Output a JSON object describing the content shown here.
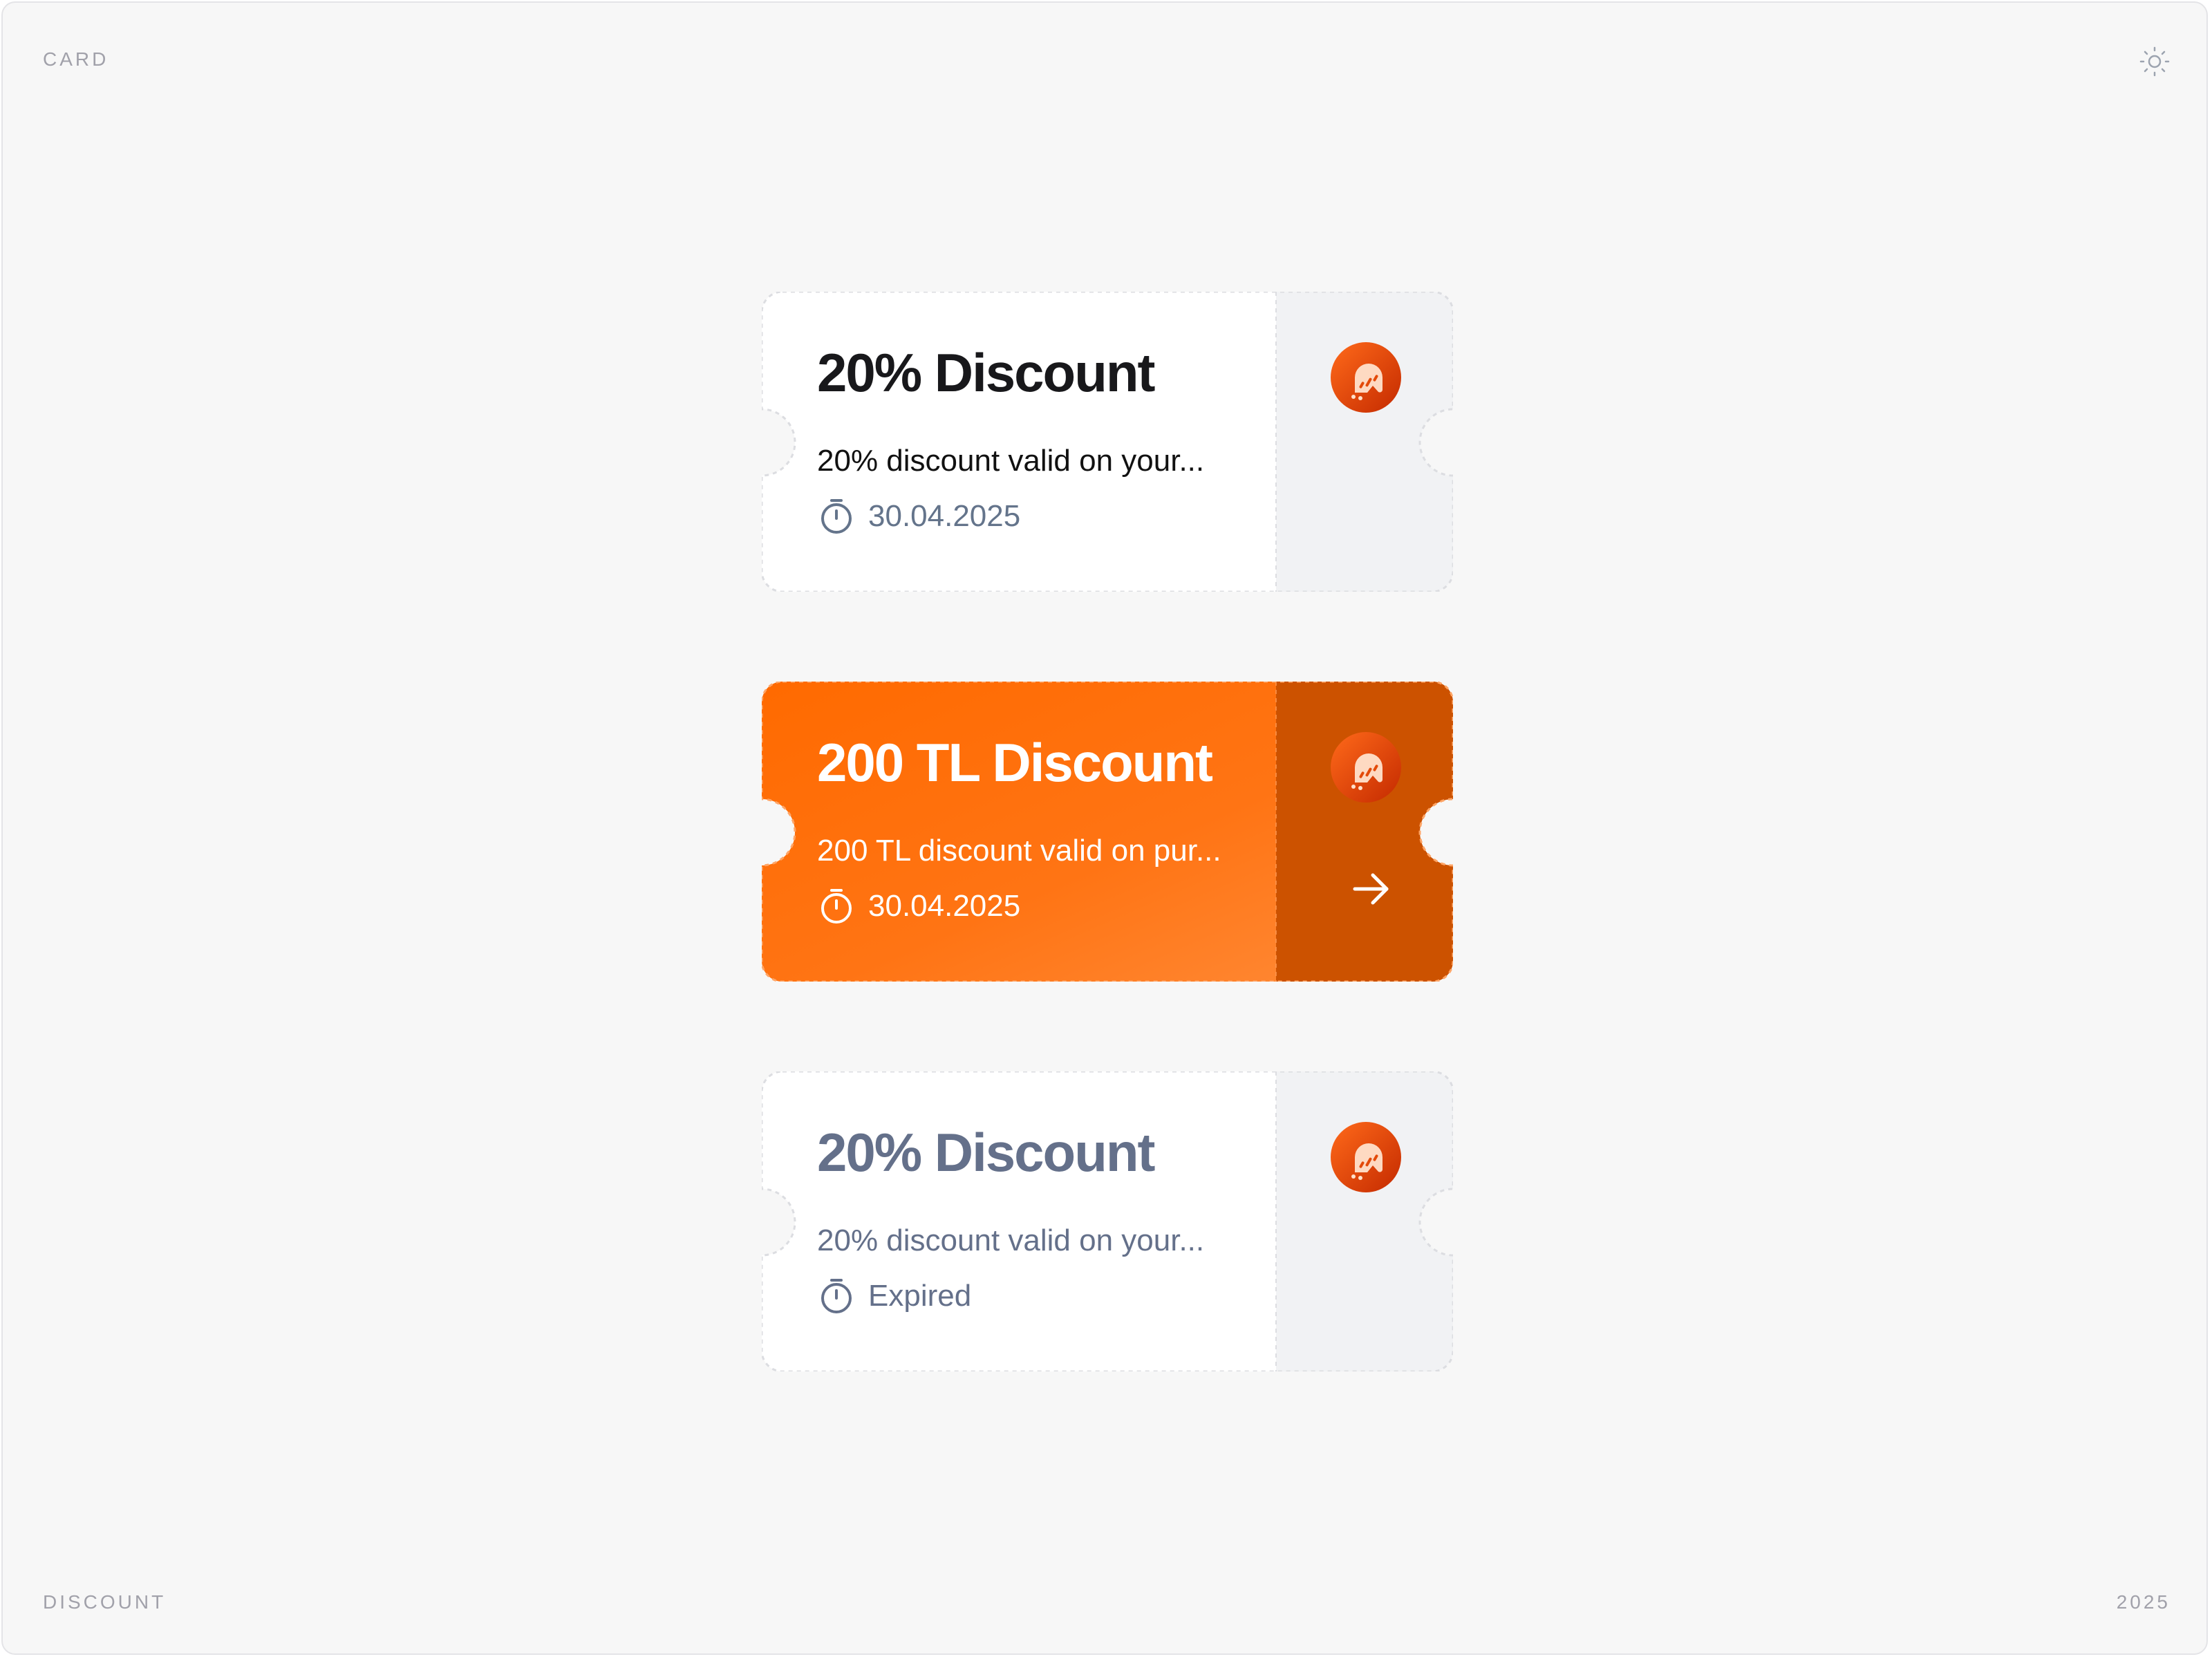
{
  "corners": {
    "top_left": "CARD",
    "bottom_left": "DISCOUNT",
    "bottom_right": "2025"
  },
  "theme_toggle": {
    "icon": "sun-icon"
  },
  "brand": {
    "accent": "#ff6a00",
    "accent_dark": "#cc5200",
    "logo_icon": "brand-logo-icon"
  },
  "coupons": [
    {
      "state": "default",
      "title": "20% Discount",
      "description": "20% discount valid on your...",
      "meta_icon": "timer-icon",
      "expiry": "30.04.2025"
    },
    {
      "state": "active",
      "title": "200 TL Discount",
      "description": "200 TL discount valid on pur...",
      "meta_icon": "timer-icon",
      "expiry": "30.04.2025",
      "action_icon": "arrow-right-icon"
    },
    {
      "state": "expired",
      "title": "20% Discount",
      "description": "20% discount valid on your...",
      "meta_icon": "timer-icon",
      "expiry": "Expired"
    }
  ]
}
